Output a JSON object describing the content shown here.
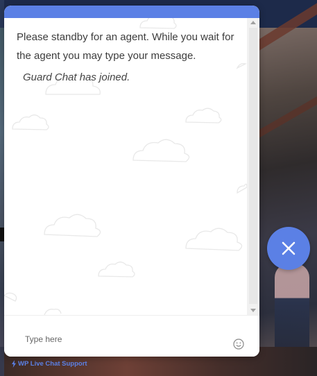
{
  "chat": {
    "messages": [
      {
        "type": "system",
        "text": "Please standby for an agent. While you wait for the agent you may type your message."
      },
      {
        "type": "event",
        "text": "Guard Chat has joined."
      }
    ],
    "input": {
      "placeholder": "Type here",
      "value": ""
    },
    "emoji_icon": "smiley-icon",
    "close_icon": "close-icon"
  },
  "branding": {
    "powered_by": "WP Live Chat Support",
    "icon": "bolt-icon"
  },
  "colors": {
    "accent": "#5b80e5",
    "text": "#3c3c3c",
    "background": "#ffffff"
  }
}
